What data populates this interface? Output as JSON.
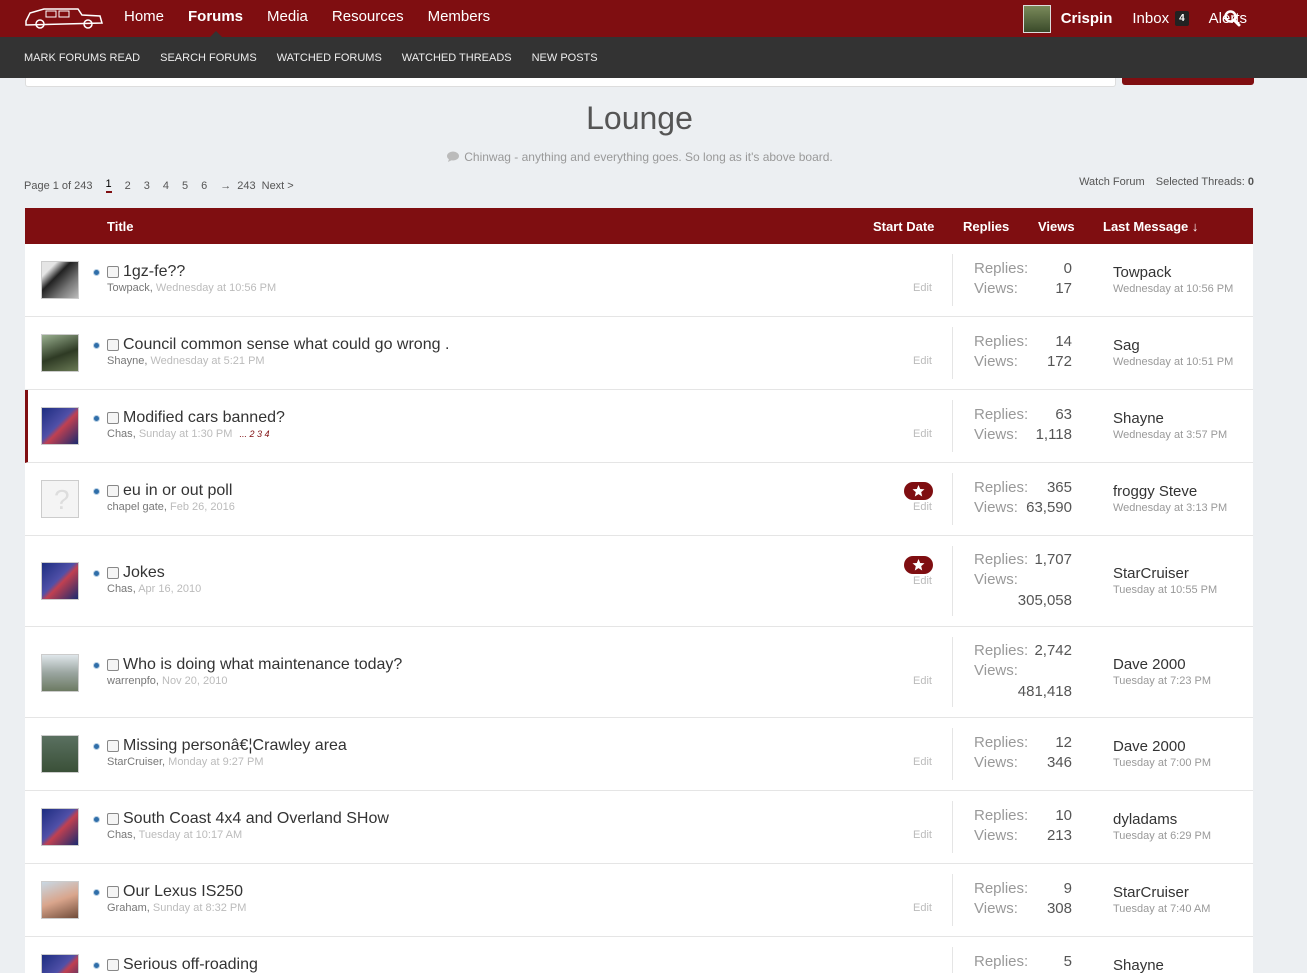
{
  "header": {
    "nav": [
      "Home",
      "Forums",
      "Media",
      "Resources",
      "Members"
    ],
    "user": "Crispin",
    "inbox_label": "Inbox",
    "inbox_count": "4",
    "alerts_label": "Alerts",
    "icons": [
      "logo",
      "search-icon"
    ]
  },
  "subnav": [
    "MARK FORUMS READ",
    "SEARCH FORUMS",
    "WATCHED FORUMS",
    "WATCHED THREADS",
    "NEW POSTS"
  ],
  "forum": {
    "title": "Lounge",
    "description": "Chinwag - anything and everything goes. So long as it's above board."
  },
  "pagination": {
    "label": "Page 1 of 243",
    "pages": [
      "1",
      "2",
      "3",
      "4",
      "5",
      "6",
      "→",
      "243",
      "Next >"
    ]
  },
  "tools": {
    "watch": "Watch Forum",
    "selected_label": "Selected Threads:",
    "selected_count": "0"
  },
  "columns": {
    "title": "Title",
    "start_date": "Start Date",
    "replies": "Replies",
    "views": "Views",
    "last_message": "Last Message ↓"
  },
  "labels": {
    "replies": "Replies:",
    "views": "Views:",
    "edit": "Edit"
  },
  "threads": [
    {
      "title": "1gz-fe??",
      "author": "Towpack",
      "date": "Wednesday at 10:56 PM",
      "replies": "0",
      "views": "17",
      "last_user": "Towpack",
      "last_date": "Wednesday at 10:56 PM"
    },
    {
      "title": "Council common sense what could go wrong .",
      "author": "Shayne",
      "date": "Wednesday at 5:21 PM",
      "replies": "14",
      "views": "172",
      "last_user": "Sag",
      "last_date": "Wednesday at 10:51 PM"
    },
    {
      "title": "Modified cars banned?",
      "author": "Chas",
      "date": "Sunday at 1:30 PM",
      "pages": "...  2  3  4",
      "replies": "63",
      "views": "1,118",
      "last_user": "Shayne",
      "last_date": "Wednesday at 3:57 PM"
    },
    {
      "title": "eu in or out poll",
      "author": "chapel gate",
      "date": "Feb 26, 2016",
      "replies": "365",
      "views": "63,590",
      "last_user": "froggy Steve",
      "last_date": "Wednesday at 3:13 PM"
    },
    {
      "title": "Jokes",
      "author": "Chas",
      "date": "Apr 16, 2010",
      "replies": "1,707",
      "views": "305,058",
      "last_user": "StarCruiser",
      "last_date": "Tuesday at 10:55 PM"
    },
    {
      "title": "Who is doing what maintenance today?",
      "author": "warrenpfo",
      "date": "Nov 20, 2010",
      "replies": "2,742",
      "views": "481,418",
      "last_user": "Dave 2000",
      "last_date": "Tuesday at 7:23 PM"
    },
    {
      "title": "Missing personâ€¦Crawley area",
      "author": "StarCruiser",
      "date": "Monday at 9:27 PM",
      "replies": "12",
      "views": "346",
      "last_user": "Dave 2000",
      "last_date": "Tuesday at 7:00 PM"
    },
    {
      "title": "South Coast 4x4 and Overland SHow",
      "author": "Chas",
      "date": "Tuesday at 10:17 AM",
      "replies": "10",
      "views": "213",
      "last_user": "dyladams",
      "last_date": "Tuesday at 6:29 PM"
    },
    {
      "title": "Our Lexus IS250",
      "author": "Graham",
      "date": "Sunday at 8:32 PM",
      "replies": "9",
      "views": "308",
      "last_user": "StarCruiser",
      "last_date": "Tuesday at 7:40 AM"
    },
    {
      "title": "Serious off-roading",
      "replies": "5",
      "last_user": "Shayne"
    }
  ],
  "colors": {
    "brand": "#7f0e11",
    "subnav": "#333333",
    "page_bg": "#eceff2"
  }
}
